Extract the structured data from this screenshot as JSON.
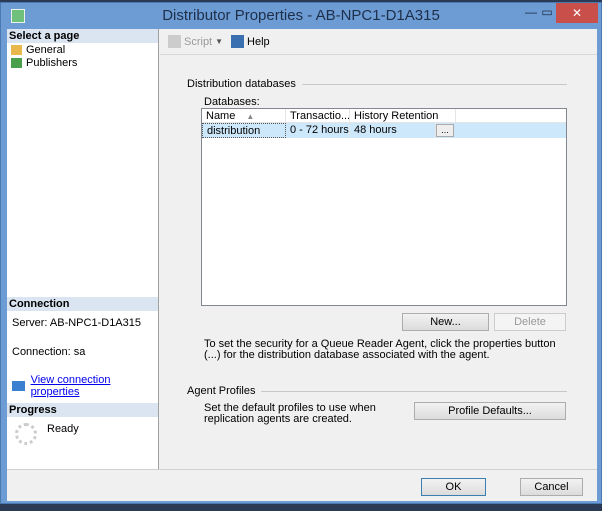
{
  "window": {
    "title": "Distributor Properties - AB-NPC1-D1A315",
    "close": "✕",
    "minimize": "—",
    "maximize": "▭"
  },
  "left": {
    "select_page": "Select a page",
    "pages": [
      {
        "label": "General"
      },
      {
        "label": "Publishers"
      }
    ],
    "connection_header": "Connection",
    "server": "Server: AB-NPC1-D1A315",
    "connection": "Connection: sa",
    "view_link": "View connection properties",
    "progress_header": "Progress",
    "progress_status": "Ready"
  },
  "toolbar": {
    "script": "Script",
    "help": "Help"
  },
  "main": {
    "dist_group": "Distribution databases",
    "databases_label": "Databases:",
    "columns": [
      "Name",
      "Transactio...",
      "History Retention"
    ],
    "rows": [
      {
        "name": "distribution",
        "transaction": "0 - 72 hours",
        "history": "48 hours",
        "button": "..."
      }
    ],
    "new_button": "New...",
    "delete_button": "Delete",
    "security_note": "To set the security for a Queue Reader Agent, click the properties button (...) for the distribution database associated with the agent.",
    "agent_group": "Agent Profiles",
    "agent_note": "Set the default profiles to use when replication agents are created.",
    "profile_button": "Profile Defaults..."
  },
  "footer": {
    "ok": "OK",
    "cancel": "Cancel"
  }
}
